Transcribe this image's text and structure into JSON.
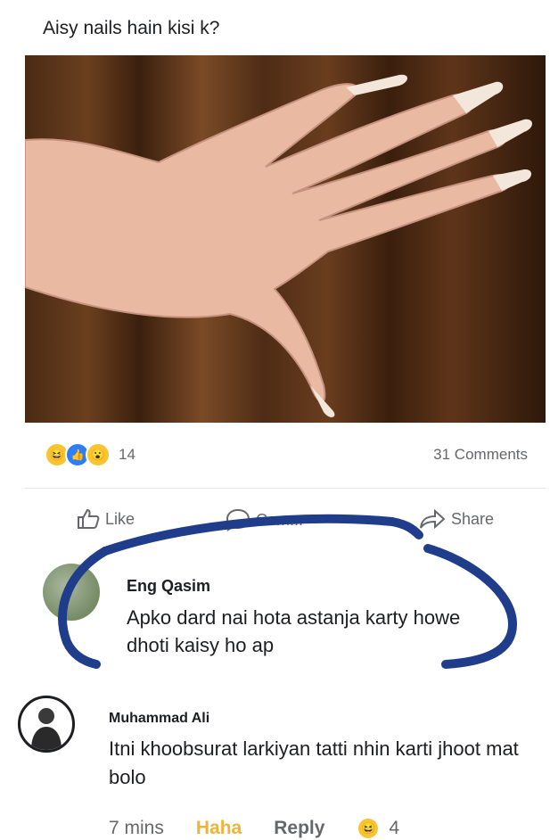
{
  "post": {
    "text": "Aisy nails hain kisi k?"
  },
  "stats": {
    "reaction_count": "14",
    "comments": "31 Comments",
    "reaction_icons": [
      "haha-icon",
      "like-icon",
      "wow-icon"
    ]
  },
  "actions": {
    "like": "Like",
    "comment": "Com...",
    "share": "Share"
  },
  "comments": [
    {
      "name": "Eng Qasim",
      "text": "Apko dard nai hota astanja karty howe dhoti kaisy ho ap"
    },
    {
      "name": "Muhammad Ali",
      "text": "Itni khoobsurat larkiyan tatti nhin karti jhoot mat bolo",
      "time": "7 mins",
      "haha": "Haha",
      "reply": "Reply",
      "reaction_count": "4"
    }
  ],
  "colors": {
    "highlight_stroke": "#1f3d8a",
    "haha_text": "#e9b53b",
    "meta_gray": "#65676b"
  }
}
